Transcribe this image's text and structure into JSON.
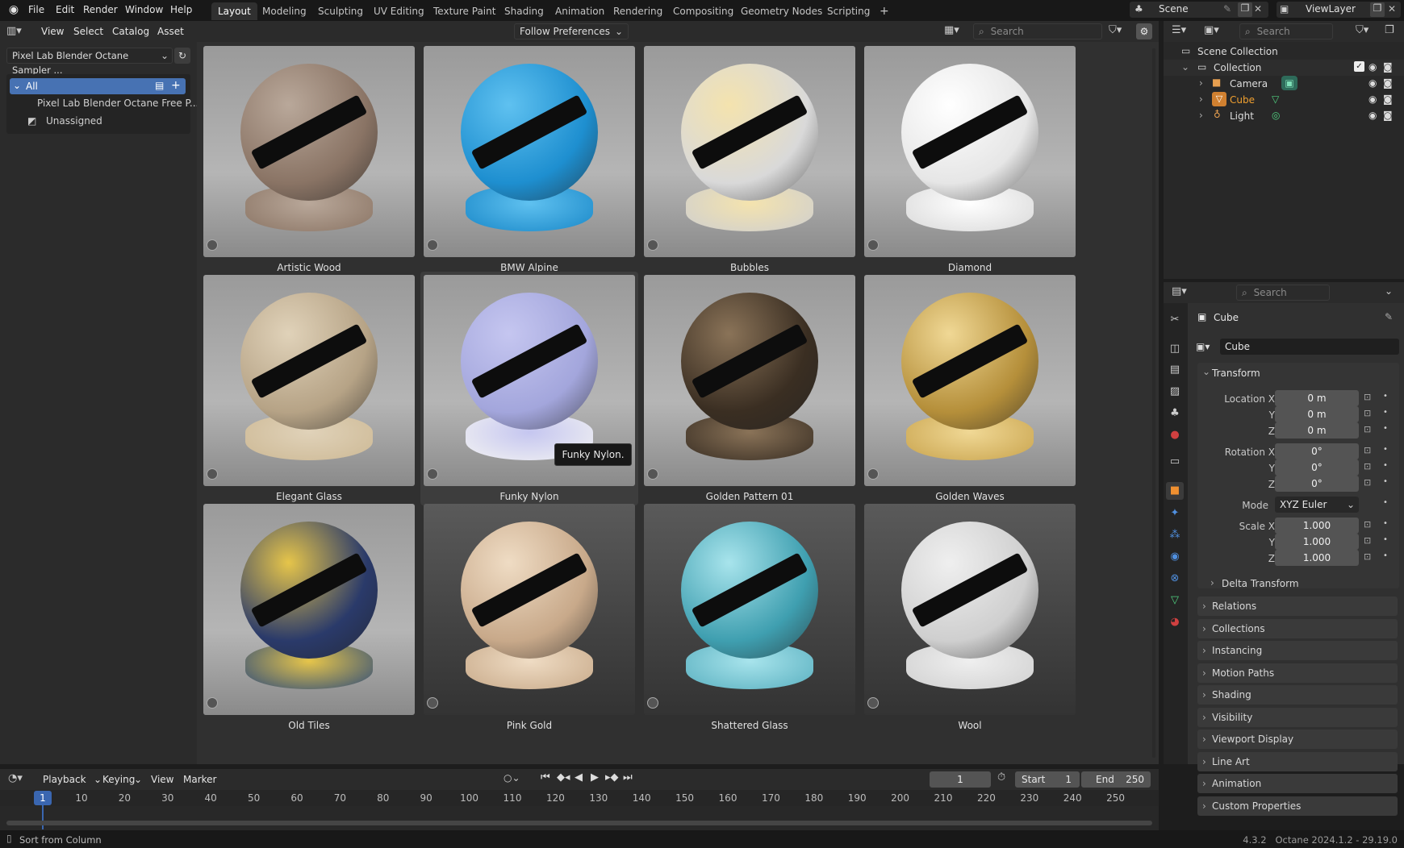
{
  "topbar": {
    "menus": [
      "File",
      "Edit",
      "Render",
      "Window",
      "Help"
    ],
    "workspaces": [
      "Layout",
      "Modeling",
      "Sculpting",
      "UV Editing",
      "Texture Paint",
      "Shading",
      "Animation",
      "Rendering",
      "Compositing",
      "Geometry Nodes",
      "Scripting"
    ],
    "active_workspace": "Layout",
    "add_tab": "+",
    "scene": "Scene",
    "view_layer": "ViewLayer"
  },
  "asset_browser": {
    "menus": [
      "View",
      "Select",
      "Catalog",
      "Asset"
    ],
    "library": "Pixel Lab Blender Octane Sampler ...",
    "import_method": "Follow Preferences",
    "search_placeholder": "Search",
    "catalog_all": "All",
    "catalog_items": [
      "Pixel Lab Blender Octane Free P...",
      "Unassigned"
    ],
    "assets": [
      {
        "name": "Artistic Wood",
        "colors": [
          "#8a7465",
          "#b9a89a"
        ],
        "base": "#8b7565"
      },
      {
        "name": "BMW Alpine",
        "colors": [
          "#1e8fd0",
          "#5fc1f0"
        ],
        "base": "#1a88c8"
      },
      {
        "name": "Bubbles",
        "colors": [
          "#d9d9d9",
          "#f4e3ae"
        ],
        "base": "#cfcfcf"
      },
      {
        "name": "Diamond",
        "colors": [
          "#e6e6e6",
          "#ffffff"
        ],
        "base": "#d9d9d9"
      },
      {
        "name": "Elegant Glass",
        "colors": [
          "#b6a386",
          "#e0d2b9"
        ],
        "base": "#cdb995"
      },
      {
        "name": "Funky Nylon",
        "colors": [
          "#a3a6dc",
          "#c5c6f0"
        ],
        "base": "#f2f2f2"
      },
      {
        "name": "Golden Pattern 01",
        "colors": [
          "#3a2e22",
          "#8a7358"
        ],
        "base": "#3a2f24"
      },
      {
        "name": "Golden Waves",
        "colors": [
          "#b58f3a",
          "#f0d895"
        ],
        "base": "#c9a44e"
      },
      {
        "name": "Old Tiles",
        "colors": [
          "#2a3a6a",
          "#e6c54a"
        ],
        "base": "#2f4c7a"
      },
      {
        "name": "Pink Gold",
        "colors": [
          "#c8a98a",
          "#efdcc4"
        ],
        "base": "#c8aa8a"
      },
      {
        "name": "Shattered Glass",
        "colors": [
          "#3f9fb0",
          "#a8e4ec"
        ],
        "base": "#5ab0c0"
      },
      {
        "name": "Wool",
        "colors": [
          "#cfcfcf",
          "#efefef"
        ],
        "base": "#d0d0d0"
      }
    ],
    "tooltip": "Funky Nylon."
  },
  "outliner": {
    "search_placeholder": "Search",
    "scene_collection": "Scene Collection",
    "collection": "Collection",
    "objects": [
      "Camera",
      "Cube",
      "Light"
    ],
    "active_object": "Cube"
  },
  "properties": {
    "search_placeholder": "Search",
    "object_name": "Cube",
    "object_field": "Cube",
    "transform_title": "Transform",
    "location_label": "Location X",
    "rotation_label": "Rotation X",
    "scale_label": "Scale X",
    "axis_y": "Y",
    "axis_z": "Z",
    "location": [
      "0 m",
      "0 m",
      "0 m"
    ],
    "rotation": [
      "0°",
      "0°",
      "0°"
    ],
    "mode_label": "Mode",
    "mode_value": "XYZ Euler",
    "scale": [
      "1.000",
      "1.000",
      "1.000"
    ],
    "delta_transform": "Delta Transform",
    "sections": [
      "Relations",
      "Collections",
      "Instancing",
      "Motion Paths",
      "Shading",
      "Visibility",
      "Viewport Display",
      "Line Art",
      "Animation",
      "Custom Properties"
    ]
  },
  "timeline": {
    "menus": [
      "Playback",
      "Keying",
      "View",
      "Marker"
    ],
    "current_frame": "1",
    "start_label": "Start",
    "start": "1",
    "end_label": "End",
    "end": "250",
    "ticks": [
      "10",
      "20",
      "30",
      "40",
      "50",
      "60",
      "70",
      "80",
      "90",
      "100",
      "110",
      "120",
      "130",
      "140",
      "150",
      "160",
      "170",
      "180",
      "190",
      "200",
      "210",
      "220",
      "230",
      "240",
      "250"
    ],
    "playhead": "1"
  },
  "statusbar": {
    "hint": "Sort from Column",
    "version": "4.3.2   Octane 2024.1.2 - 29.19.0"
  },
  "colors": {
    "accent": "#4772b3",
    "active_orange": "#f0a030",
    "selected_blue": "#3a66b0"
  }
}
